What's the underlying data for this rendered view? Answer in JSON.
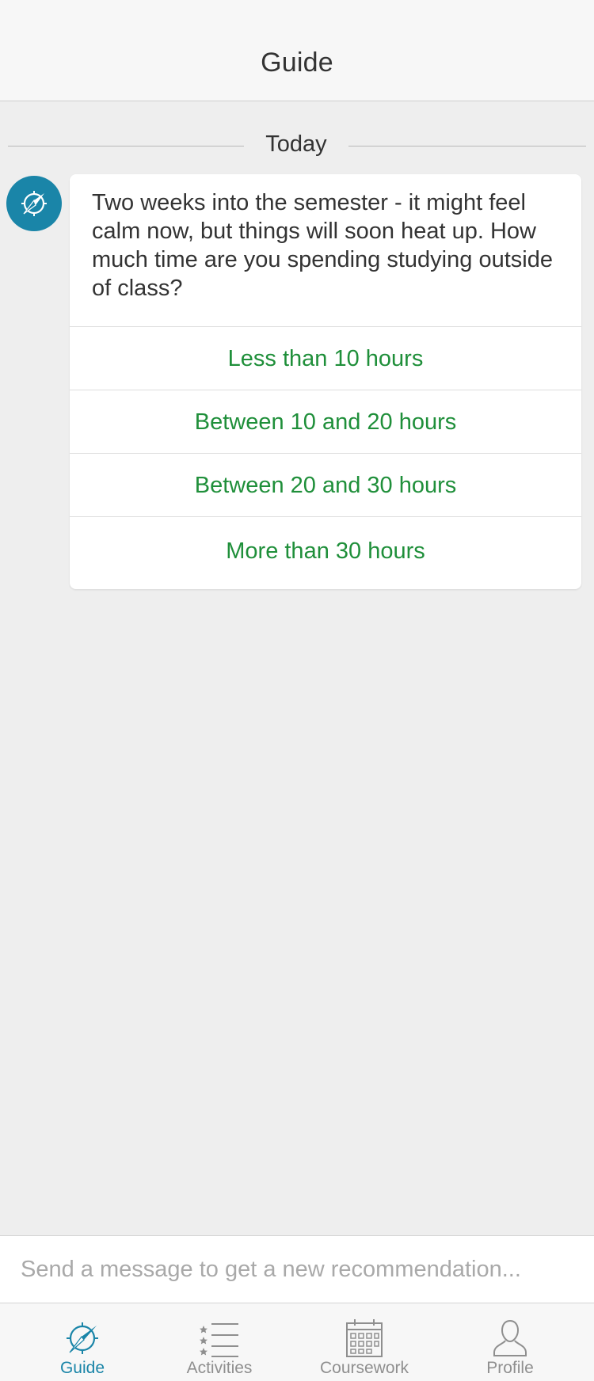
{
  "header": {
    "title": "Guide"
  },
  "feed": {
    "date_divider": "Today",
    "message": {
      "avatar_icon": "compass-icon",
      "text": "Two weeks into the semester - it might feel calm now, but things will soon heat up. How much time are you spending studying outside of class?",
      "options": [
        "Less than 10 hours",
        "Between 10 and 20 hours",
        "Between 20 and 30 hours",
        "More than 30 hours"
      ]
    }
  },
  "composer": {
    "placeholder": "Send a message to get a new recommendation..."
  },
  "tabbar": {
    "items": [
      {
        "label": "Guide",
        "icon": "compass-icon",
        "active": true
      },
      {
        "label": "Activities",
        "icon": "star-list-icon",
        "active": false
      },
      {
        "label": "Coursework",
        "icon": "calendar-icon",
        "active": false
      },
      {
        "label": "Profile",
        "icon": "person-icon",
        "active": false
      }
    ]
  },
  "colors": {
    "accent": "#1a85a8",
    "option_text": "#1f8f3a",
    "background": "#eeeeee"
  }
}
